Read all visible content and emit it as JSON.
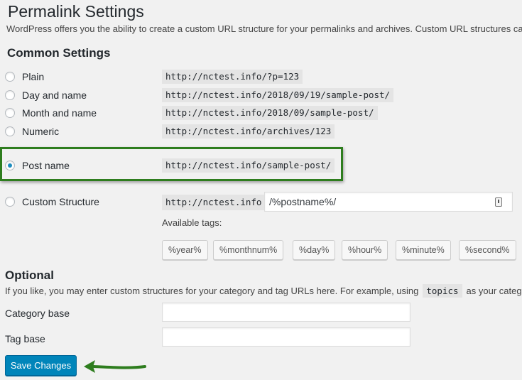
{
  "header": {
    "title": "Permalink Settings",
    "intro": "WordPress offers you the ability to create a custom URL structure for your permalinks and archives. Custom URL structures can"
  },
  "common": {
    "heading": "Common Settings",
    "options": [
      {
        "label": "Plain",
        "example": "http://nctest.info/?p=123",
        "checked": false
      },
      {
        "label": "Day and name",
        "example": "http://nctest.info/2018/09/19/sample-post/",
        "checked": false
      },
      {
        "label": "Month and name",
        "example": "http://nctest.info/2018/09/sample-post/",
        "checked": false
      },
      {
        "label": "Numeric",
        "example": "http://nctest.info/archives/123",
        "checked": false
      },
      {
        "label": "Post name",
        "example": "http://nctest.info/sample-post/",
        "checked": true
      }
    ],
    "custom": {
      "label": "Custom Structure",
      "prefix": "http://nctest.info",
      "value": "/%postname%/"
    },
    "available_tags_label": "Available tags:",
    "tags": [
      "%year%",
      "%monthnum%",
      "%day%",
      "%hour%",
      "%minute%",
      "%second%"
    ]
  },
  "optional": {
    "heading": "Optional",
    "desc_before": "If you like, you may enter custom structures for your category and tag URLs here. For example, using",
    "desc_code": "topics",
    "desc_after": "as your category",
    "category_base_label": "Category base",
    "category_base_value": "",
    "tag_base_label": "Tag base",
    "tag_base_value": ""
  },
  "save_label": "Save Changes",
  "colors": {
    "highlight": "#2e7d1e",
    "primary_button": "#0085ba",
    "radio_checked": "#1e8cbe"
  }
}
